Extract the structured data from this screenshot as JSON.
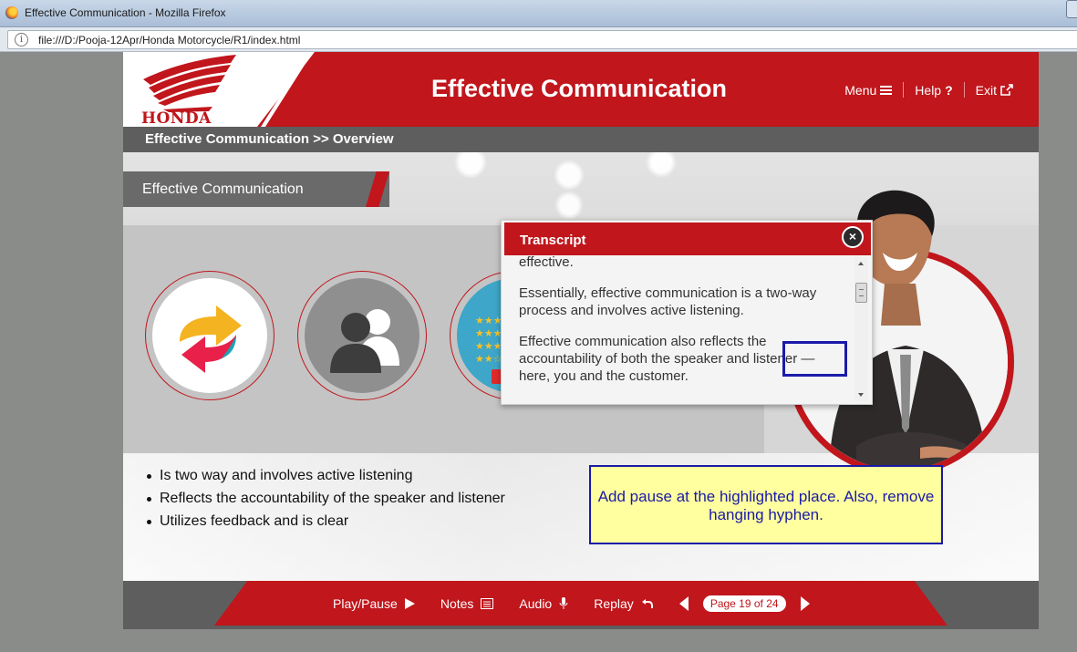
{
  "browser": {
    "window_title": "Effective Communication - Mozilla Firefox",
    "url": "file:///D:/Pooja-12Apr/Honda Motorcycle/R1/index.html",
    "info_icon": "i"
  },
  "header": {
    "logo_text": "HONDA",
    "title": "Effective Communication",
    "nav": [
      {
        "label": "Menu",
        "icon": "hamburger-icon"
      },
      {
        "label": "Help",
        "icon": "question-icon",
        "glyph": "?"
      },
      {
        "label": "Exit",
        "icon": "external-link-icon"
      }
    ]
  },
  "breadcrumb": "Effective Communication >> Overview",
  "section_title": "Effective Communication",
  "icons": [
    "two-way-arrows-icon",
    "people-icon",
    "rating-icon"
  ],
  "bullets": [
    "Is two way and involves active listening",
    "Reflects the accountability of the speaker and listener",
    "Utilizes feedback and is clear"
  ],
  "transcript": {
    "title": "Transcript",
    "close_glyph": "×",
    "paragraphs": [
      "effective.",
      "Essentially, effective communication is a two-way process and involves active listening.",
      "Effective communication also reflects the accountability of both the speaker and listener — here, you and the customer."
    ]
  },
  "review_note": "Add pause at the highlighted place. Also, remove hanging hyphen.",
  "footer": {
    "play_pause": "Play/Pause",
    "notes": "Notes",
    "audio": "Audio",
    "replay": "Replay",
    "page_indicator": "Page 19 of 24"
  },
  "colors": {
    "brand_red": "#c0161c",
    "dark_gray": "#5e5e5e",
    "note_fill": "#ffff9f",
    "note_border": "#1a1aa8"
  }
}
